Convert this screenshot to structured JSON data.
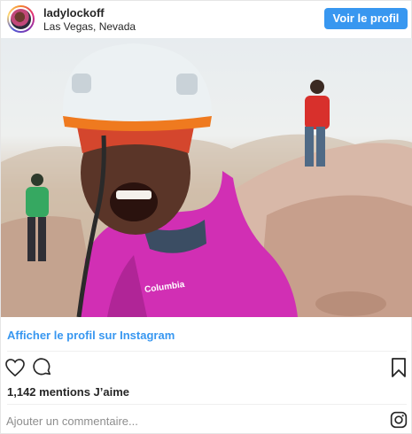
{
  "post": {
    "username": "ladylockoff",
    "location": "Las Vegas, Nevada",
    "follow_label": "Voir le profil",
    "photo_brand_text": "Columbia"
  },
  "footer": {
    "view_profile_link": "Afficher le profil sur Instagram",
    "likes_text": "1,142 mentions J’aime",
    "comment_placeholder": "Ajouter un commentaire..."
  },
  "icons": {
    "like": "heart-icon",
    "comment": "comment-bubble-icon",
    "save": "bookmark-icon",
    "brand": "instagram-logo-icon"
  },
  "colors": {
    "accent": "#3897f0",
    "text": "#262626",
    "muted": "#8e8e8e"
  }
}
